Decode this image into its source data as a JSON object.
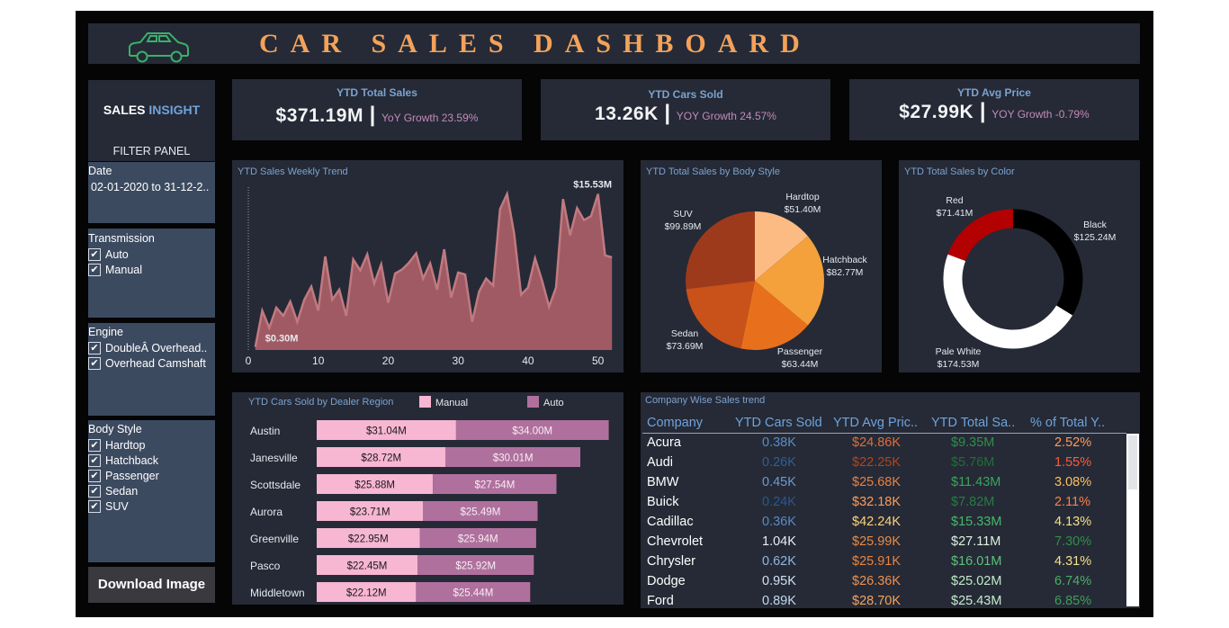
{
  "header": {
    "title": "CAR SALES DASHBOARD",
    "title_color": "#f4a259",
    "logo_icon": "car-icon"
  },
  "sidebar": {
    "brand_sales": "SALES",
    "brand_insight": "INSIGHT",
    "filter_panel_label": "FILTER PANEL",
    "date": {
      "label": "Date",
      "value": "02-01-2020 to 31-12-2.."
    },
    "transmission": {
      "label": "Transmission",
      "options": [
        "Auto",
        "Manual"
      ]
    },
    "engine": {
      "label": "Engine",
      "options": [
        "DoubleÂ Overhead..",
        "Overhead Camshaft"
      ]
    },
    "body_style": {
      "label": "Body Style",
      "options": [
        "Hardtop",
        "Hatchback",
        "Passenger",
        "Sedan",
        "SUV"
      ]
    },
    "download_button": "Download Image"
  },
  "kpis": [
    {
      "title": "YTD Total Sales",
      "value": "$371.19M",
      "growth": "YoY Growth 23.59%"
    },
    {
      "title": "YTD Cars Sold",
      "value": "13.26K",
      "growth": "YOY Growth 24.57%"
    },
    {
      "title": "YTD Avg Price",
      "value": "$27.99K",
      "growth": "YOY Growth -0.79%"
    }
  ],
  "weekly_trend_title": "YTD Sales Weekly Trend",
  "body_style_title": "YTD Total Sales by Body Style",
  "color_title": "YTD Total Sales by Color",
  "dealer_title": "YTD Cars Sold by Dealer Region",
  "company_title": "Company Wise Sales trend",
  "colors": {
    "accent_blue": "#7ba2cf",
    "manual": "#f7b6d2",
    "auto": "#b0709e",
    "area": "#a05a64",
    "area_line": "#c07a80"
  },
  "chart_data": [
    {
      "type": "area",
      "title": "YTD Sales Weekly Trend",
      "x": [
        1,
        2,
        3,
        4,
        5,
        6,
        7,
        8,
        9,
        10,
        11,
        12,
        13,
        14,
        15,
        16,
        17,
        18,
        19,
        20,
        21,
        22,
        23,
        24,
        25,
        26,
        27,
        28,
        29,
        30,
        31,
        32,
        33,
        34,
        35,
        36,
        37,
        38,
        39,
        40,
        41,
        42,
        43,
        44,
        45,
        46,
        47,
        48,
        49,
        50,
        51,
        52
      ],
      "values": [
        0.3,
        3.9,
        2.2,
        4.2,
        3.4,
        4.8,
        2.8,
        5.0,
        6.3,
        3.9,
        9.3,
        5.0,
        6.0,
        3.4,
        9.0,
        7.9,
        9.5,
        6.6,
        8.5,
        4.7,
        7.6,
        8.0,
        8.7,
        9.6,
        7.1,
        8.6,
        6.0,
        10.0,
        5.2,
        7.7,
        7.5,
        2.8,
        5.8,
        7.1,
        6.4,
        14.0,
        15.5,
        11.6,
        5.5,
        6.2,
        9.1,
        6.9,
        4.3,
        6.2,
        15.0,
        11.4,
        14.1,
        12.9,
        13.3,
        15.5,
        9.4,
        9.2
      ],
      "xticks": [
        0,
        10,
        20,
        30,
        40,
        50
      ],
      "xlim": [
        0,
        53
      ],
      "ylim": [
        0,
        16
      ],
      "annotations": [
        {
          "x": 50,
          "label": "$15.53M"
        },
        {
          "x": 1,
          "label": "$0.30M"
        }
      ]
    },
    {
      "type": "pie",
      "title": "YTD Total Sales by Body Style",
      "categories": [
        "Hardtop",
        "Hatchback",
        "Passenger",
        "Sedan",
        "SUV"
      ],
      "values": [
        51.4,
        82.77,
        63.44,
        73.69,
        99.89
      ],
      "labels": [
        "$51.40M",
        "$82.77M",
        "$63.44M",
        "$73.69M",
        "$99.89M"
      ],
      "colors": [
        "#fdbb84",
        "#f4a03b",
        "#e8701c",
        "#c9511a",
        "#9e3a1c"
      ]
    },
    {
      "type": "pie",
      "title": "YTD Total Sales by Color",
      "categories": [
        "Black",
        "Pale White",
        "Red"
      ],
      "values": [
        125.24,
        174.53,
        71.41
      ],
      "labels": [
        "$125.24M",
        "$174.53M",
        "$71.41M"
      ],
      "colors": [
        "#000000",
        "#ffffff",
        "#b30000"
      ]
    },
    {
      "type": "bar",
      "title": "YTD Cars Sold by Dealer Region",
      "categories": [
        "Austin",
        "Janesville",
        "Scottsdale",
        "Aurora",
        "Greenville",
        "Pasco",
        "Middletown"
      ],
      "series": [
        {
          "name": "Manual",
          "values": [
            31.04,
            28.72,
            25.88,
            23.71,
            22.95,
            22.45,
            22.12
          ],
          "labels": [
            "$31.04M",
            "$28.72M",
            "$25.88M",
            "$23.71M",
            "$22.95M",
            "$22.45M",
            "$22.12M"
          ]
        },
        {
          "name": "Auto",
          "values": [
            34.0,
            30.01,
            27.54,
            25.49,
            25.94,
            25.92,
            25.44
          ],
          "labels": [
            "$34.00M",
            "$30.01M",
            "$27.54M",
            "$25.49M",
            "$25.94M",
            "$25.92M",
            "$25.44M"
          ]
        }
      ],
      "stacked": true,
      "legend": "top"
    },
    {
      "type": "table",
      "title": "Company Wise Sales trend",
      "columns": [
        "Company",
        "YTD Cars Sold",
        "YTD Avg Pric..",
        "YTD Total Sa..",
        "% of Total Y.."
      ],
      "rows": [
        {
          "cells": [
            "Acura",
            "0.38K",
            "$24.86K",
            "$9.35M",
            "2.52%"
          ],
          "colors": [
            "#ffffff",
            "#5b8cc5",
            "#e06d3a",
            "#2f8f4a",
            "#ff9a5a"
          ]
        },
        {
          "cells": [
            "Audi",
            "0.26K",
            "$22.25K",
            "$5.76M",
            "1.55%"
          ],
          "colors": [
            "#ffffff",
            "#2f5f96",
            "#b5431c",
            "#1f6f37",
            "#ff5a36"
          ]
        },
        {
          "cells": [
            "BMW",
            "0.45K",
            "$25.68K",
            "$11.43M",
            "3.08%"
          ],
          "colors": [
            "#ffffff",
            "#6b9bd2",
            "#e88140",
            "#3aa55a",
            "#ffc05c"
          ]
        },
        {
          "cells": [
            "Buick",
            "0.24K",
            "$32.18K",
            "$7.82M",
            "2.11%"
          ],
          "colors": [
            "#ffffff",
            "#2a5890",
            "#ff9a5a",
            "#287c42",
            "#ff7f4a"
          ]
        },
        {
          "cells": [
            "Cadillac",
            "0.36K",
            "$42.24K",
            "$15.33M",
            "4.13%"
          ],
          "colors": [
            "#ffffff",
            "#5a8ac4",
            "#ffd27a",
            "#46b868",
            "#f5e08a"
          ]
        },
        {
          "cells": [
            "Chevrolet",
            "1.04K",
            "$25.99K",
            "$27.11M",
            "7.30%"
          ],
          "colors": [
            "#ffffff",
            "#e6eef8",
            "#e88a44",
            "#dcf2dc",
            "#2f8f4a"
          ]
        },
        {
          "cells": [
            "Chrysler",
            "0.62K",
            "$25.91K",
            "$16.01M",
            "4.31%"
          ],
          "colors": [
            "#ffffff",
            "#8fb6e0",
            "#e8843f",
            "#5cc27a",
            "#f5e08a"
          ]
        },
        {
          "cells": [
            "Dodge",
            "0.95K",
            "$26.36K",
            "$25.02M",
            "6.74%"
          ],
          "colors": [
            "#ffffff",
            "#d2e1f2",
            "#ee9050",
            "#c2eac8",
            "#4cae68"
          ]
        },
        {
          "cells": [
            "Ford",
            "0.89K",
            "$28.70K",
            "$25.43M",
            "6.85%"
          ],
          "colors": [
            "#ffffff",
            "#c4d8ef",
            "#f4a35e",
            "#c8ecce",
            "#3e9f5a"
          ]
        }
      ]
    }
  ]
}
